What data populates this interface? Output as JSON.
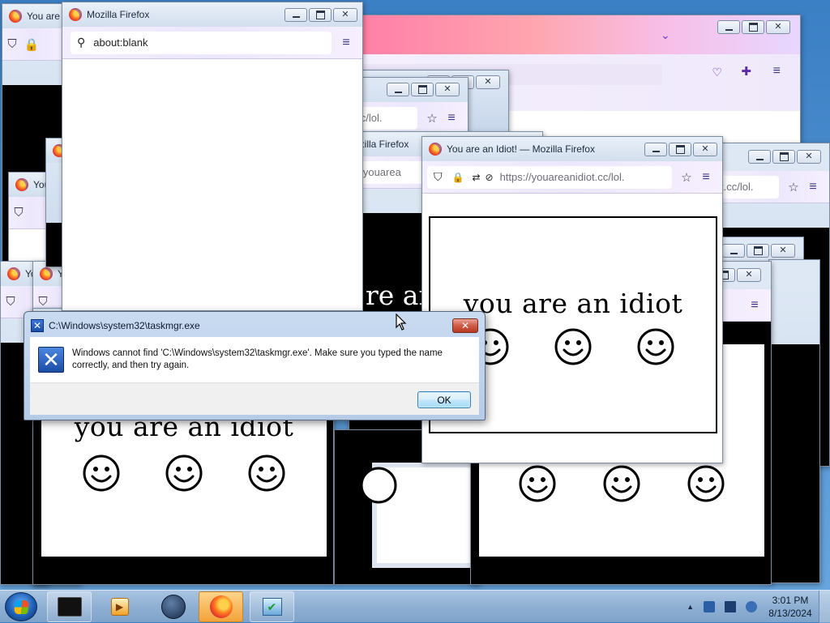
{
  "browser": {
    "app_name": "Mozilla Firefox",
    "idiot_title": "You are an Idiot! — Mozilla Firefox",
    "idiot_title_short": "You are a",
    "idiot_title_tiny": "You",
    "blank_url": "about:blank",
    "site_url": "https://youareanidiot.cc/lol.",
    "site_url_frag": "t.cc/lol.",
    "site_url_frag2": "://youarea",
    "ff_title_frag": "ozilla Firefox",
    "page_text": "you are an idiot",
    "page_text_frag": "re an"
  },
  "icons": {
    "shield": "shield-icon",
    "lock": "lock-icon",
    "star": "star-icon",
    "menu": "hamburger-menu-icon",
    "search": "search-icon",
    "tracking": "tracking-protection-icon",
    "pocket": "pocket-icon",
    "extensions": "extensions-icon"
  },
  "dialog": {
    "title": "C:\\Windows\\system32\\taskmgr.exe",
    "message": "Windows cannot find 'C:\\Windows\\system32\\taskmgr.exe'. Make sure you typed the name correctly, and then try again.",
    "ok_label": "OK"
  },
  "taskbar": {
    "apps": [
      "cmd-prompt-icon",
      "media-player-icon",
      "globe-icon",
      "firefox-icon",
      "task-app-icon"
    ],
    "clock_time": "3:01 PM",
    "clock_date": "8/13/2024"
  },
  "colors": {
    "firefox_toolbar": "#ede8fb",
    "dialog_title_bg": "#c9dbf1",
    "taskbar": "#8fb0d4",
    "ok_button": "#bee6fd"
  }
}
